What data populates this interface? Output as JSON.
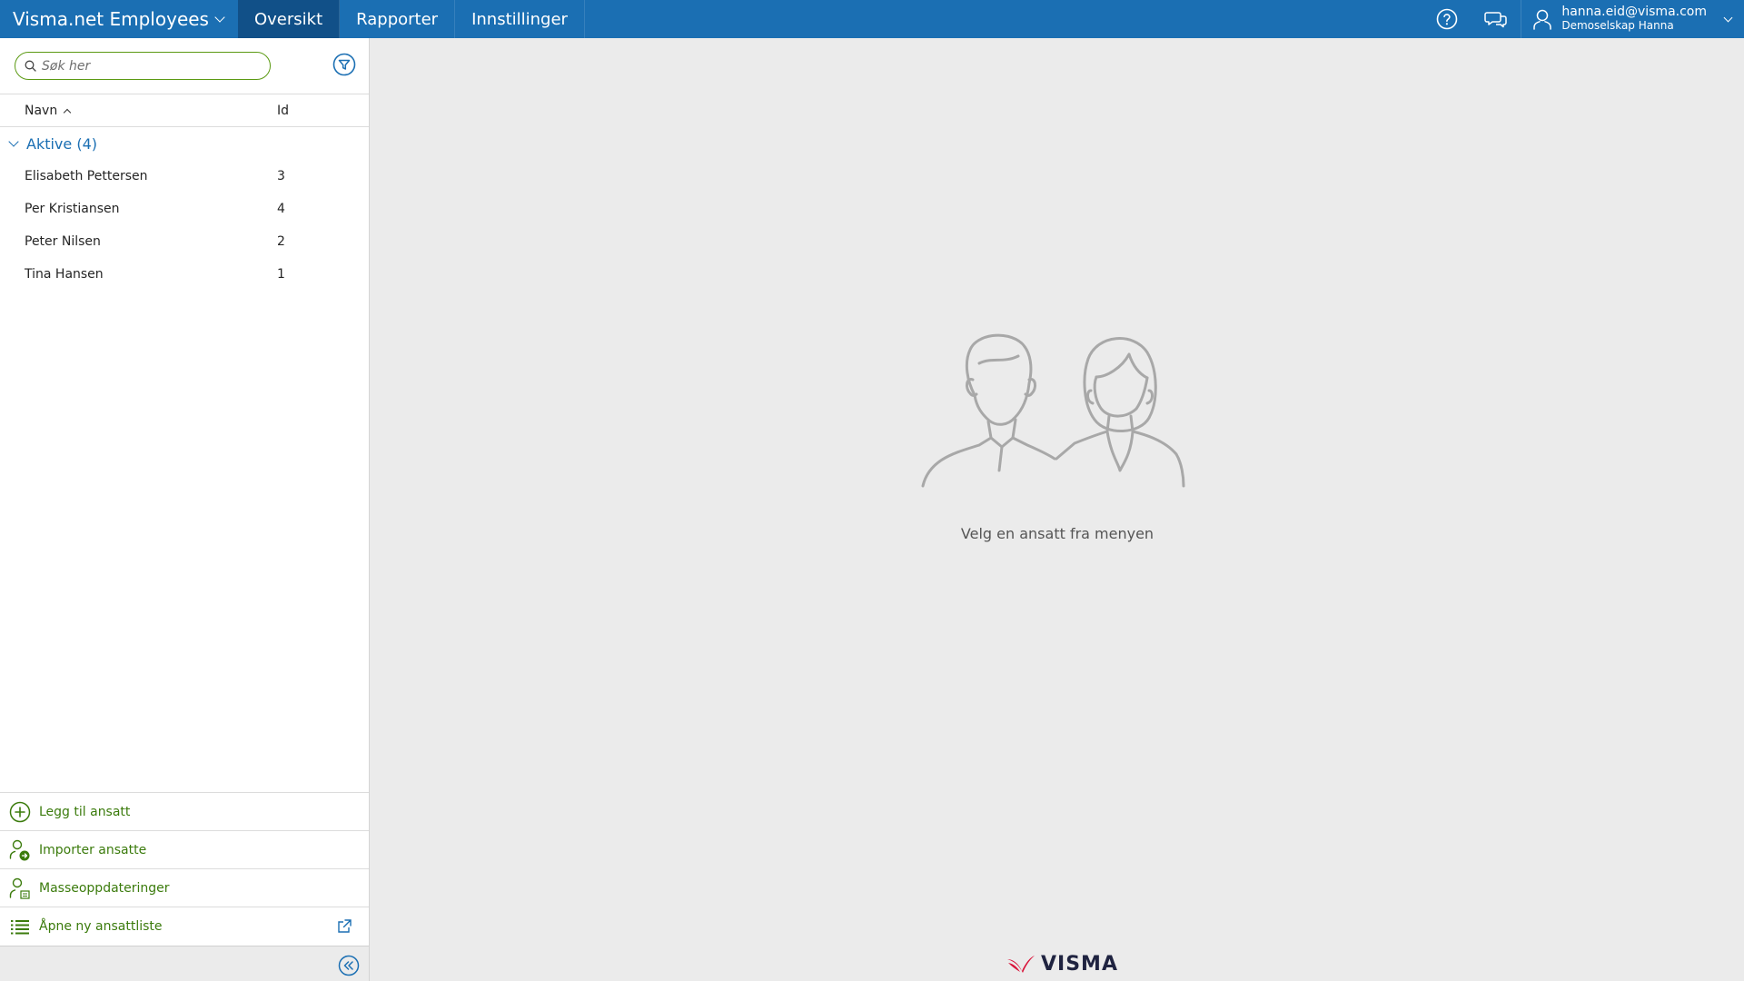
{
  "topbar": {
    "brand": "Visma.net Employees",
    "tabs": [
      {
        "label": "Oversikt",
        "active": true
      },
      {
        "label": "Rapporter",
        "active": false
      },
      {
        "label": "Innstillinger",
        "active": false
      }
    ],
    "user": {
      "email": "hanna.eid@visma.com",
      "company": "Demoselskap Hanna"
    },
    "icons": [
      "help-icon",
      "chat-icon",
      "user-icon"
    ]
  },
  "sidebar": {
    "search": {
      "placeholder": "Søk her",
      "value": ""
    },
    "columns": {
      "name": "Navn",
      "id": "Id"
    },
    "group": {
      "label": "Aktive (4)"
    },
    "employees": [
      {
        "name": "Elisabeth Pettersen",
        "id": "3"
      },
      {
        "name": "Per Kristiansen",
        "id": "4"
      },
      {
        "name": "Peter Nilsen",
        "id": "2"
      },
      {
        "name": "Tina Hansen",
        "id": "1"
      }
    ],
    "actions": [
      {
        "label": "Legg til ansatt",
        "icon": "plus-circle-icon"
      },
      {
        "label": "Importer ansatte",
        "icon": "import-user-icon"
      },
      {
        "label": "Masseoppdateringer",
        "icon": "mass-update-icon"
      },
      {
        "label": "Åpne ny ansattliste",
        "icon": "list-icon"
      }
    ]
  },
  "main": {
    "empty_message": "Velg en ansatt fra menyen",
    "logo_text": "VISMA"
  },
  "colors": {
    "topbar": "#1b6fb3",
    "active_tab": "#115088",
    "accent_green": "#3b7b0c",
    "link_blue": "#1b6fb3",
    "logo_red": "#d9143a"
  }
}
